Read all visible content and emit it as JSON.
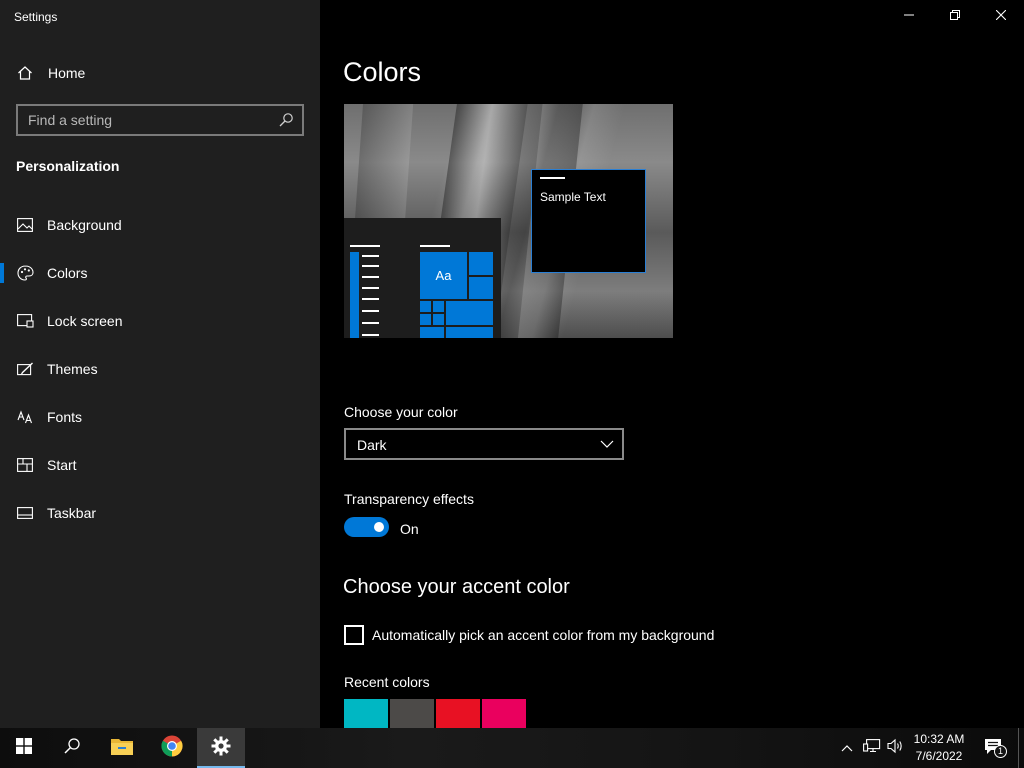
{
  "window": {
    "title": "Settings",
    "controls": {
      "minimize": "minimize-icon",
      "maximize": "restore-icon",
      "close": "close-icon"
    }
  },
  "sidebar": {
    "home_label": "Home",
    "search": {
      "placeholder": "Find a setting",
      "value": ""
    },
    "section_title": "Personalization",
    "items": [
      {
        "label": "Background",
        "icon": "image-icon"
      },
      {
        "label": "Colors",
        "icon": "palette-icon",
        "selected": true
      },
      {
        "label": "Lock screen",
        "icon": "lock-screen-icon"
      },
      {
        "label": "Themes",
        "icon": "brush-icon"
      },
      {
        "label": "Fonts",
        "icon": "fonts-icon"
      },
      {
        "label": "Start",
        "icon": "start-icon"
      },
      {
        "label": "Taskbar",
        "icon": "taskbar-icon"
      }
    ]
  },
  "main": {
    "title": "Colors",
    "preview": {
      "sample_text": "Sample Text",
      "tile_text": "Aa"
    },
    "choose_color": {
      "label": "Choose your color",
      "value": "Dark"
    },
    "transparency": {
      "label": "Transparency effects",
      "state_label": "On",
      "on": true
    },
    "accent": {
      "heading": "Choose your accent color",
      "auto_label": "Automatically pick an accent color from my background",
      "auto_checked": false
    },
    "recent_colors": {
      "label": "Recent colors",
      "colors": [
        "#00b7c3",
        "#4c4a48",
        "#e81123",
        "#ea005e"
      ]
    }
  },
  "colors": {
    "accent": "#0078d7",
    "sidebar_bg": "#1f1f1f",
    "content_bg": "#000000"
  },
  "taskbar": {
    "apps": [
      "windows-start-icon",
      "search-icon",
      "file-explorer-icon",
      "chrome-icon",
      "settings-gear-icon"
    ],
    "clock": {
      "time": "10:32 AM",
      "date": "7/6/2022"
    },
    "notification_count": "1"
  }
}
